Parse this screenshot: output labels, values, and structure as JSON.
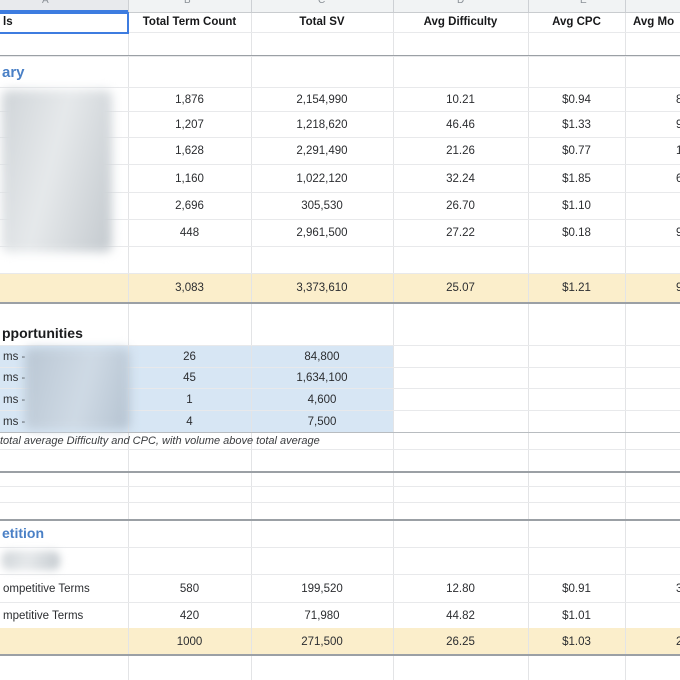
{
  "columns": {
    "headers": [
      "ls",
      "Total Term Count",
      "Total SV",
      "Avg Difficulty",
      "Avg CPC",
      "Avg Mo"
    ]
  },
  "strip_letters": [
    "A",
    "B",
    "C",
    "D",
    "E"
  ],
  "summary": {
    "heading": "ary",
    "rows": [
      {
        "count": "1,876",
        "sv": "2,154,990",
        "difficulty": "10.21",
        "cpc": "$0.94",
        "m": "8"
      },
      {
        "count": "1,207",
        "sv": "1,218,620",
        "difficulty": "46.46",
        "cpc": "$1.33",
        "m": "9"
      },
      {
        "count": "1,628",
        "sv": "2,291,490",
        "difficulty": "21.26",
        "cpc": "$0.77",
        "m": "1"
      },
      {
        "count": "1,160",
        "sv": "1,022,120",
        "difficulty": "32.24",
        "cpc": "$1.85",
        "m": "6"
      },
      {
        "count": "2,696",
        "sv": "305,530",
        "difficulty": "26.70",
        "cpc": "$1.10",
        "m": ""
      },
      {
        "count": "448",
        "sv": "2,961,500",
        "difficulty": "27.22",
        "cpc": "$0.18",
        "m": "9"
      }
    ],
    "total": {
      "count": "3,083",
      "sv": "3,373,610",
      "difficulty": "25.07",
      "cpc": "$1.21",
      "m": "9"
    }
  },
  "opportunities": {
    "heading": "pportunities",
    "rows": [
      {
        "label": "ms -",
        "count": "26",
        "sv": "84,800"
      },
      {
        "label": "ms -",
        "count": "45",
        "sv": "1,634,100"
      },
      {
        "label": "ms -",
        "count": "1",
        "sv": "4,600"
      },
      {
        "label": "ms -",
        "count": "4",
        "sv": "7,500"
      }
    ],
    "note": "total average Difficulty and CPC, with volume above total average"
  },
  "competition": {
    "heading": "etition",
    "rows": [
      {
        "label": "ompetitive Terms",
        "count": "580",
        "sv": "199,520",
        "difficulty": "12.80",
        "cpc": "$0.91",
        "m": "3"
      },
      {
        "label": "mpetitive Terms",
        "count": "420",
        "sv": "71,980",
        "difficulty": "44.82",
        "cpc": "$1.01",
        "m": ""
      }
    ],
    "total": {
      "count": "1000",
      "sv": "271,500",
      "difficulty": "26.25",
      "cpc": "$1.03",
      "m": "2"
    }
  },
  "colors": {
    "heading_blue": "#4a80c6",
    "selection_blue": "#3d7ce0",
    "total_row_yellow": "#fbeecb",
    "highlight_blue": "#d7e6f4",
    "gridline": "#e3e4e6",
    "section_divider": "#9ba0a5"
  }
}
